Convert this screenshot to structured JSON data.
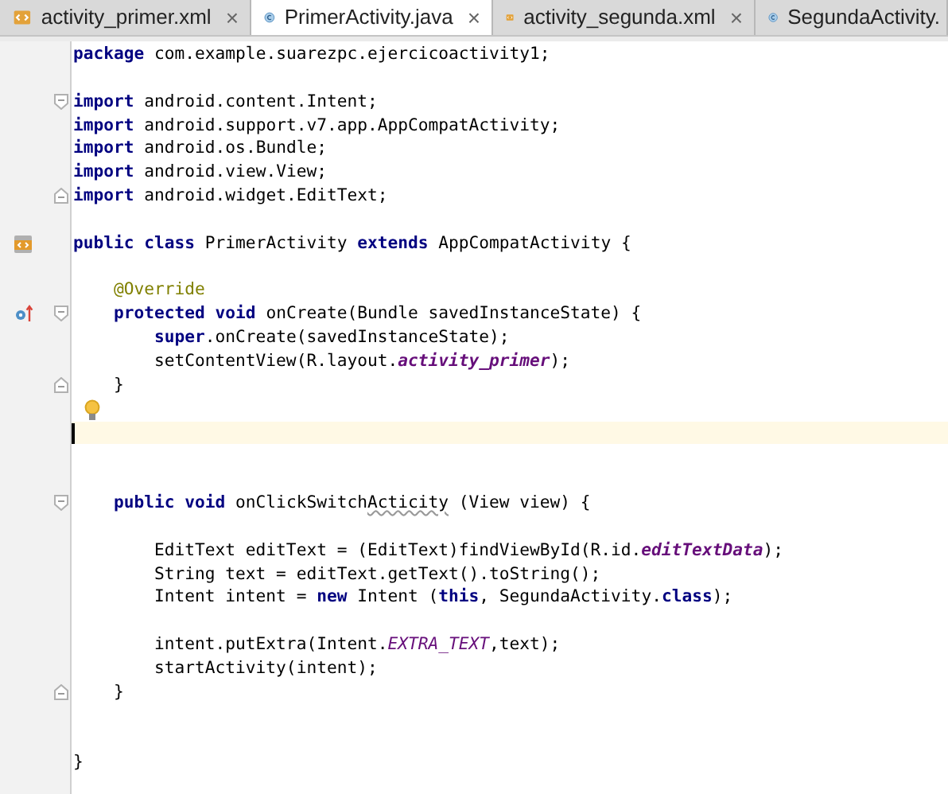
{
  "tabs": [
    {
      "label": "activity_primer.xml",
      "kind": "xml",
      "selected": false,
      "closable": true
    },
    {
      "label": "PrimerActivity.java",
      "kind": "class",
      "selected": true,
      "closable": true
    },
    {
      "label": "activity_segunda.xml",
      "kind": "xml",
      "selected": false,
      "closable": true
    },
    {
      "label": "SegundaActivity.",
      "kind": "class",
      "selected": false,
      "closable": false
    }
  ],
  "close_glyph": "×",
  "lines": [
    {
      "blank_after": true,
      "segments": [
        {
          "text": "package",
          "kind": "keyword"
        },
        {
          "text": " com.example.suarezpc.ejercicoactivity1;",
          "kind": "plain"
        }
      ]
    },
    {
      "fold_start": true,
      "segments": [
        {
          "text": "import",
          "kind": "keyword"
        },
        {
          "text": " android.content.Intent;",
          "kind": "plain"
        }
      ]
    },
    {
      "segments": [
        {
          "text": "import",
          "kind": "keyword"
        },
        {
          "text": " android.support.v7.app.AppCompatActivity;",
          "kind": "plain"
        }
      ]
    },
    {
      "segments": [
        {
          "text": "import",
          "kind": "keyword"
        },
        {
          "text": " android.os.Bundle;",
          "kind": "plain"
        }
      ]
    },
    {
      "segments": [
        {
          "text": "import",
          "kind": "keyword"
        },
        {
          "text": " android.view.View;",
          "kind": "plain"
        }
      ]
    },
    {
      "fold_end": true,
      "blank_after": true,
      "segments": [
        {
          "text": "import",
          "kind": "keyword"
        },
        {
          "text": " android.widget.EditText;",
          "kind": "plain"
        }
      ]
    },
    {
      "class_icon": true,
      "blank_after": true,
      "segments": [
        {
          "text": "public class",
          "kind": "keyword"
        },
        {
          "text": " PrimerActivity ",
          "kind": "plain"
        },
        {
          "text": "extends",
          "kind": "keyword"
        },
        {
          "text": " AppCompatActivity {",
          "kind": "plain"
        }
      ]
    },
    {
      "segments": [
        {
          "text": "    @Override",
          "kind": "annotation"
        }
      ]
    },
    {
      "override_icon": true,
      "fold_start": true,
      "segments": [
        {
          "text": "    protected void",
          "kind": "keyword"
        },
        {
          "text": " onCreate(Bundle savedInstanceState) {",
          "kind": "plain"
        }
      ]
    },
    {
      "segments": [
        {
          "text": "        super",
          "kind": "keyword"
        },
        {
          "text": ".onCreate(savedInstanceState);",
          "kind": "plain"
        }
      ]
    },
    {
      "segments": [
        {
          "text": "        setContentView(R.layout.",
          "kind": "plain"
        },
        {
          "text": "activity_primer",
          "kind": "field"
        },
        {
          "text": ");",
          "kind": "plain"
        }
      ]
    },
    {
      "fold_end": true,
      "segments": [
        {
          "text": "    }",
          "kind": "plain"
        }
      ]
    },
    {
      "bulb": true
    },
    {
      "current": true,
      "blank_after": true
    },
    {
      "fold_start": true,
      "blank_before": true,
      "blank_after": true,
      "segments": [
        {
          "text": "    public void",
          "kind": "keyword"
        },
        {
          "text": " onClickSwitch",
          "kind": "plain"
        },
        {
          "text": "Acticity",
          "kind": "typo"
        },
        {
          "text": " (View view) {",
          "kind": "plain"
        }
      ]
    },
    {
      "segments": [
        {
          "text": "        EditText editText = (EditText)findViewById(R.id.",
          "kind": "plain"
        },
        {
          "text": "editTextData",
          "kind": "field"
        },
        {
          "text": ");",
          "kind": "plain"
        }
      ]
    },
    {
      "segments": [
        {
          "text": "        String text = editText.getText().toString();",
          "kind": "plain"
        }
      ]
    },
    {
      "blank_after": true,
      "segments": [
        {
          "text": "        Intent intent = ",
          "kind": "plain"
        },
        {
          "text": "new",
          "kind": "keyword"
        },
        {
          "text": " Intent (",
          "kind": "plain"
        },
        {
          "text": "this",
          "kind": "keyword"
        },
        {
          "text": ", SegundaActivity.",
          "kind": "plain"
        },
        {
          "text": "class",
          "kind": "keyword"
        },
        {
          "text": ");",
          "kind": "plain"
        }
      ]
    },
    {
      "segments": [
        {
          "text": "        intent.putExtra(Intent.",
          "kind": "plain"
        },
        {
          "text": "EXTRA_TEXT",
          "kind": "static"
        },
        {
          "text": ",text);",
          "kind": "plain"
        }
      ]
    },
    {
      "segments": [
        {
          "text": "        startActivity(intent);",
          "kind": "plain"
        }
      ]
    },
    {
      "fold_end": true,
      "blank_after": true,
      "segments": [
        {
          "text": "    }",
          "kind": "plain"
        }
      ]
    },
    {
      "blank_before": true,
      "segments": [
        {
          "text": "}",
          "kind": "plain"
        }
      ]
    }
  ]
}
